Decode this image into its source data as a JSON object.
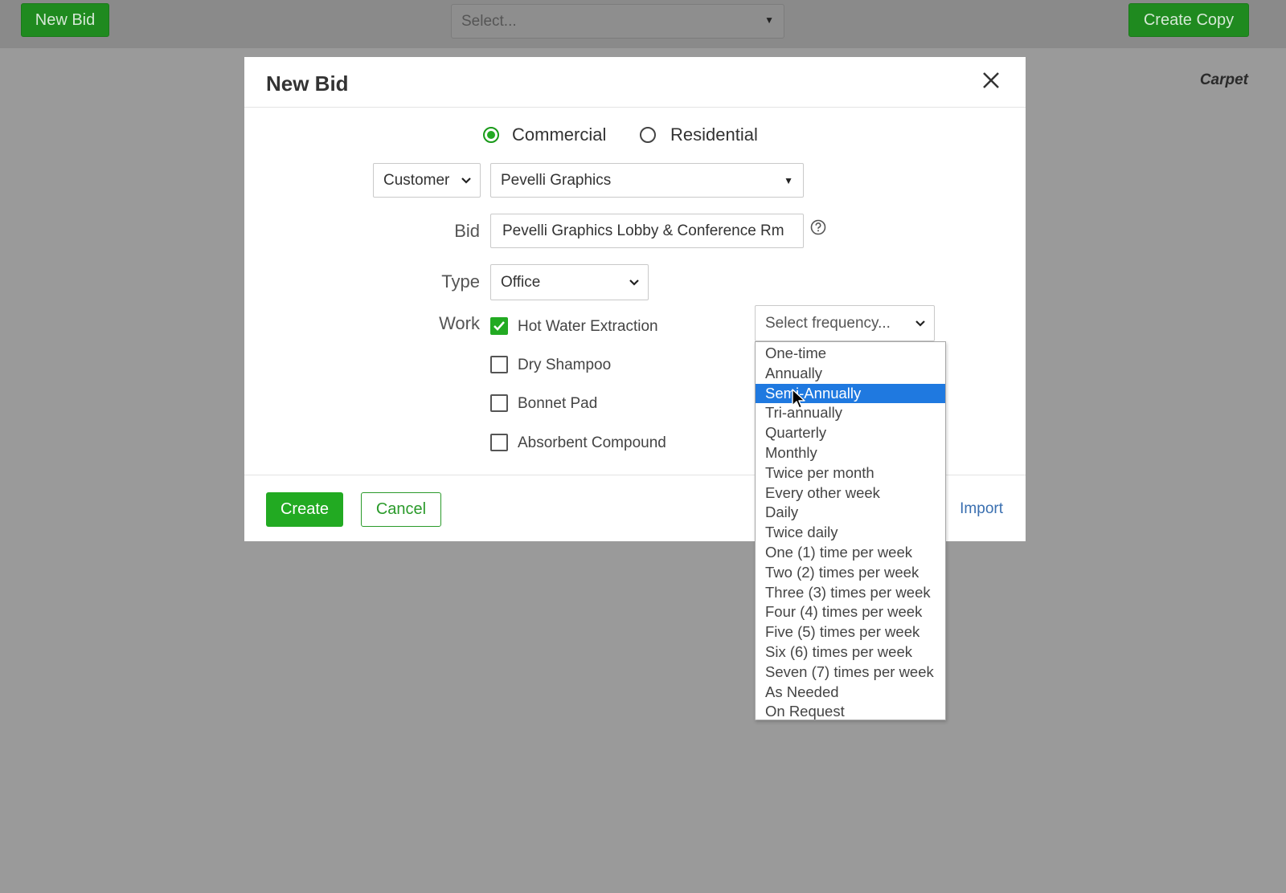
{
  "topbar": {
    "new_bid_label": "New Bid",
    "select_placeholder": "Select...",
    "create_copy_label": "Create Copy",
    "side_label": "Carpet"
  },
  "modal": {
    "title": "New Bid",
    "client_type": {
      "options": [
        "Commercial",
        "Residential"
      ],
      "selected": "Commercial"
    },
    "customer_kind": "Customer",
    "customer_name": "Pevelli Graphics",
    "bid_label": "Bid",
    "bid_value": "Pevelli Graphics Lobby & Conference Rm",
    "type_label": "Type",
    "type_value": "Office",
    "work_label": "Work",
    "work_items": [
      {
        "label": "Hot Water Extraction",
        "checked": true
      },
      {
        "label": "Dry Shampoo",
        "checked": false
      },
      {
        "label": "Bonnet Pad",
        "checked": false
      },
      {
        "label": "Absorbent Compound",
        "checked": false
      }
    ],
    "frequency_placeholder": "Select frequency...",
    "footer": {
      "create_label": "Create",
      "cancel_label": "Cancel",
      "import_label": "Import"
    }
  },
  "frequency_options": [
    "One-time",
    "Annually",
    "Semi-Annually",
    "Tri-annually",
    "Quarterly",
    "Monthly",
    "Twice per month",
    "Every other week",
    "Daily",
    "Twice daily",
    "One (1) time per week",
    "Two (2) times per week",
    "Three (3) times per week",
    "Four (4) times per week",
    "Five (5) times per week",
    "Six (6) times per week",
    "Seven (7) times per week",
    "As Needed",
    "On Request"
  ],
  "frequency_highlighted": "Semi-Annually",
  "colors": {
    "accent_green": "#22aa22",
    "highlight_blue": "#1f79e0",
    "link_blue": "#3a6fb0"
  }
}
